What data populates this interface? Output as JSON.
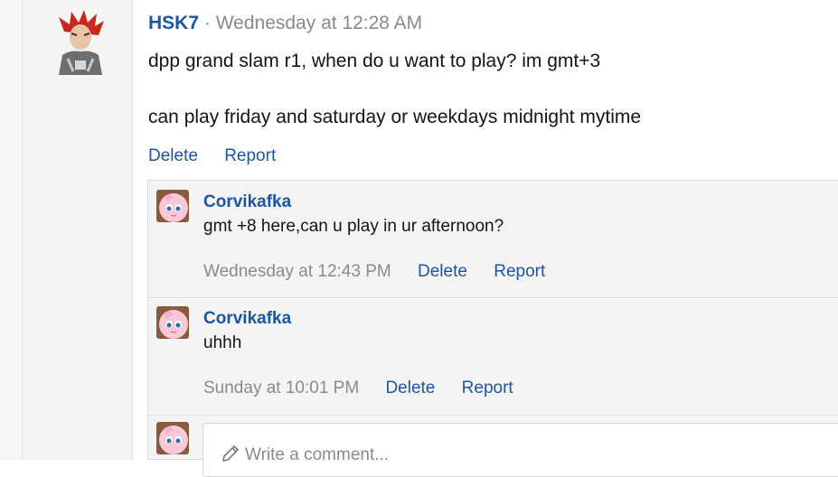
{
  "post": {
    "username": "HSK7",
    "separator": "·",
    "time": "Wednesday at 12:28 AM",
    "body_line1": "dpp grand slam r1, when do u want to play? im gmt+3",
    "body_line2": "can play friday and saturday or weekdays midnight mytime",
    "delete_label": "Delete",
    "report_label": "Report"
  },
  "comments": [
    {
      "username": "Corvikafka",
      "text": "gmt +8 here,can u play in ur afternoon?",
      "time": "Wednesday at 12:43 PM",
      "delete_label": "Delete",
      "report_label": "Report"
    },
    {
      "username": "Corvikafka",
      "text": "uhhh",
      "time": "Sunday at 10:01 PM",
      "delete_label": "Delete",
      "report_label": "Report"
    }
  ],
  "reply": {
    "placeholder": "Write a comment..."
  },
  "colors": {
    "link": "#1e55a4",
    "username": "#1a56a6",
    "muted": "#8a8a8a"
  },
  "icons": {
    "poster_avatar": "red-haired-character-avatar-icon",
    "commenter_avatar": "pink-round-character-avatar-icon",
    "reply": "pencil-icon"
  }
}
